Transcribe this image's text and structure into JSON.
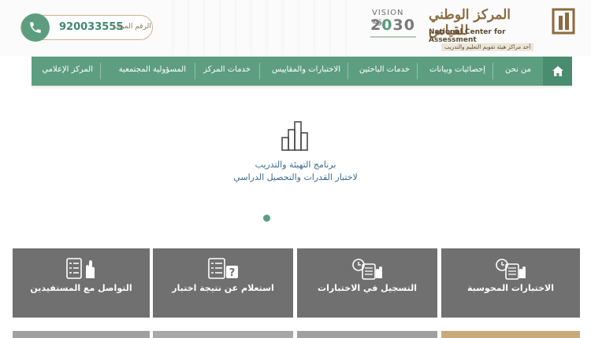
{
  "header": {
    "phone_number": "920033555",
    "phone_label": "الرقم الموحد",
    "vision_top": "VISION رؤية",
    "vision_num_a": "2",
    "vision_num_b": "0",
    "vision_num_c": "30",
    "logo_ar": "المركز الوطني للقياس",
    "logo_en": "National Center for Assessment",
    "logo_tag": "أحد مراكز هيئة تقويم التعليم والتدريب"
  },
  "nav": {
    "items": [
      "من نحن",
      "إحصائيات وبيانات",
      "خدمات الباحثين",
      "الاختبارات والمقاييس",
      "خدمات المركز",
      "المسؤولية المجتمعية",
      "المركز الإعلامي"
    ]
  },
  "hero": {
    "title": "برنامج التهيئة والتدريب",
    "subtitle": "لاختبار القدرات والتحصيل الدراسي"
  },
  "tiles": [
    {
      "label": "التواصل مع المستفيدين",
      "icon": "checklist-hand-icon"
    },
    {
      "label": "استعلام عن نتيجة اختبار",
      "icon": "checklist-question-icon"
    },
    {
      "label": "التسجيل في الاختبارات",
      "icon": "clock-checklist-icon"
    },
    {
      "label": "الاختبارات المحوسبة",
      "icon": "clock-computer-icon"
    }
  ],
  "colors": {
    "primary_green": "#5d9e81",
    "tile_gray": "#707070",
    "brand_gold": "#8c6a3f"
  }
}
